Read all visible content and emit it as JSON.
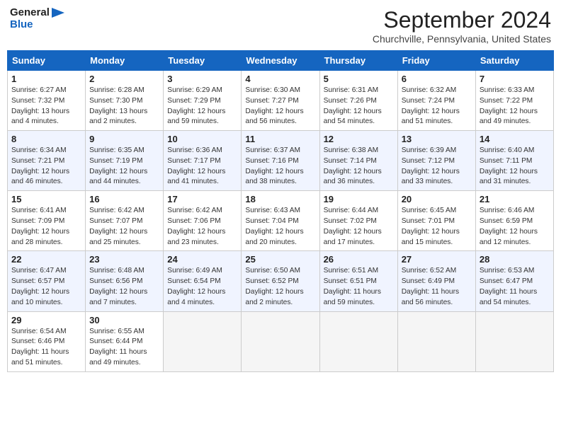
{
  "header": {
    "logo_line1": "General",
    "logo_line2": "Blue",
    "month_title": "September 2024",
    "location": "Churchville, Pennsylvania, United States"
  },
  "weekdays": [
    "Sunday",
    "Monday",
    "Tuesday",
    "Wednesday",
    "Thursday",
    "Friday",
    "Saturday"
  ],
  "weeks": [
    [
      {
        "day": "1",
        "info": "Sunrise: 6:27 AM\nSunset: 7:32 PM\nDaylight: 13 hours\nand 4 minutes."
      },
      {
        "day": "2",
        "info": "Sunrise: 6:28 AM\nSunset: 7:30 PM\nDaylight: 13 hours\nand 2 minutes."
      },
      {
        "day": "3",
        "info": "Sunrise: 6:29 AM\nSunset: 7:29 PM\nDaylight: 12 hours\nand 59 minutes."
      },
      {
        "day": "4",
        "info": "Sunrise: 6:30 AM\nSunset: 7:27 PM\nDaylight: 12 hours\nand 56 minutes."
      },
      {
        "day": "5",
        "info": "Sunrise: 6:31 AM\nSunset: 7:26 PM\nDaylight: 12 hours\nand 54 minutes."
      },
      {
        "day": "6",
        "info": "Sunrise: 6:32 AM\nSunset: 7:24 PM\nDaylight: 12 hours\nand 51 minutes."
      },
      {
        "day": "7",
        "info": "Sunrise: 6:33 AM\nSunset: 7:22 PM\nDaylight: 12 hours\nand 49 minutes."
      }
    ],
    [
      {
        "day": "8",
        "info": "Sunrise: 6:34 AM\nSunset: 7:21 PM\nDaylight: 12 hours\nand 46 minutes."
      },
      {
        "day": "9",
        "info": "Sunrise: 6:35 AM\nSunset: 7:19 PM\nDaylight: 12 hours\nand 44 minutes."
      },
      {
        "day": "10",
        "info": "Sunrise: 6:36 AM\nSunset: 7:17 PM\nDaylight: 12 hours\nand 41 minutes."
      },
      {
        "day": "11",
        "info": "Sunrise: 6:37 AM\nSunset: 7:16 PM\nDaylight: 12 hours\nand 38 minutes."
      },
      {
        "day": "12",
        "info": "Sunrise: 6:38 AM\nSunset: 7:14 PM\nDaylight: 12 hours\nand 36 minutes."
      },
      {
        "day": "13",
        "info": "Sunrise: 6:39 AM\nSunset: 7:12 PM\nDaylight: 12 hours\nand 33 minutes."
      },
      {
        "day": "14",
        "info": "Sunrise: 6:40 AM\nSunset: 7:11 PM\nDaylight: 12 hours\nand 31 minutes."
      }
    ],
    [
      {
        "day": "15",
        "info": "Sunrise: 6:41 AM\nSunset: 7:09 PM\nDaylight: 12 hours\nand 28 minutes."
      },
      {
        "day": "16",
        "info": "Sunrise: 6:42 AM\nSunset: 7:07 PM\nDaylight: 12 hours\nand 25 minutes."
      },
      {
        "day": "17",
        "info": "Sunrise: 6:42 AM\nSunset: 7:06 PM\nDaylight: 12 hours\nand 23 minutes."
      },
      {
        "day": "18",
        "info": "Sunrise: 6:43 AM\nSunset: 7:04 PM\nDaylight: 12 hours\nand 20 minutes."
      },
      {
        "day": "19",
        "info": "Sunrise: 6:44 AM\nSunset: 7:02 PM\nDaylight: 12 hours\nand 17 minutes."
      },
      {
        "day": "20",
        "info": "Sunrise: 6:45 AM\nSunset: 7:01 PM\nDaylight: 12 hours\nand 15 minutes."
      },
      {
        "day": "21",
        "info": "Sunrise: 6:46 AM\nSunset: 6:59 PM\nDaylight: 12 hours\nand 12 minutes."
      }
    ],
    [
      {
        "day": "22",
        "info": "Sunrise: 6:47 AM\nSunset: 6:57 PM\nDaylight: 12 hours\nand 10 minutes."
      },
      {
        "day": "23",
        "info": "Sunrise: 6:48 AM\nSunset: 6:56 PM\nDaylight: 12 hours\nand 7 minutes."
      },
      {
        "day": "24",
        "info": "Sunrise: 6:49 AM\nSunset: 6:54 PM\nDaylight: 12 hours\nand 4 minutes."
      },
      {
        "day": "25",
        "info": "Sunrise: 6:50 AM\nSunset: 6:52 PM\nDaylight: 12 hours\nand 2 minutes."
      },
      {
        "day": "26",
        "info": "Sunrise: 6:51 AM\nSunset: 6:51 PM\nDaylight: 11 hours\nand 59 minutes."
      },
      {
        "day": "27",
        "info": "Sunrise: 6:52 AM\nSunset: 6:49 PM\nDaylight: 11 hours\nand 56 minutes."
      },
      {
        "day": "28",
        "info": "Sunrise: 6:53 AM\nSunset: 6:47 PM\nDaylight: 11 hours\nand 54 minutes."
      }
    ],
    [
      {
        "day": "29",
        "info": "Sunrise: 6:54 AM\nSunset: 6:46 PM\nDaylight: 11 hours\nand 51 minutes."
      },
      {
        "day": "30",
        "info": "Sunrise: 6:55 AM\nSunset: 6:44 PM\nDaylight: 11 hours\nand 49 minutes."
      },
      {
        "day": "",
        "info": ""
      },
      {
        "day": "",
        "info": ""
      },
      {
        "day": "",
        "info": ""
      },
      {
        "day": "",
        "info": ""
      },
      {
        "day": "",
        "info": ""
      }
    ]
  ]
}
